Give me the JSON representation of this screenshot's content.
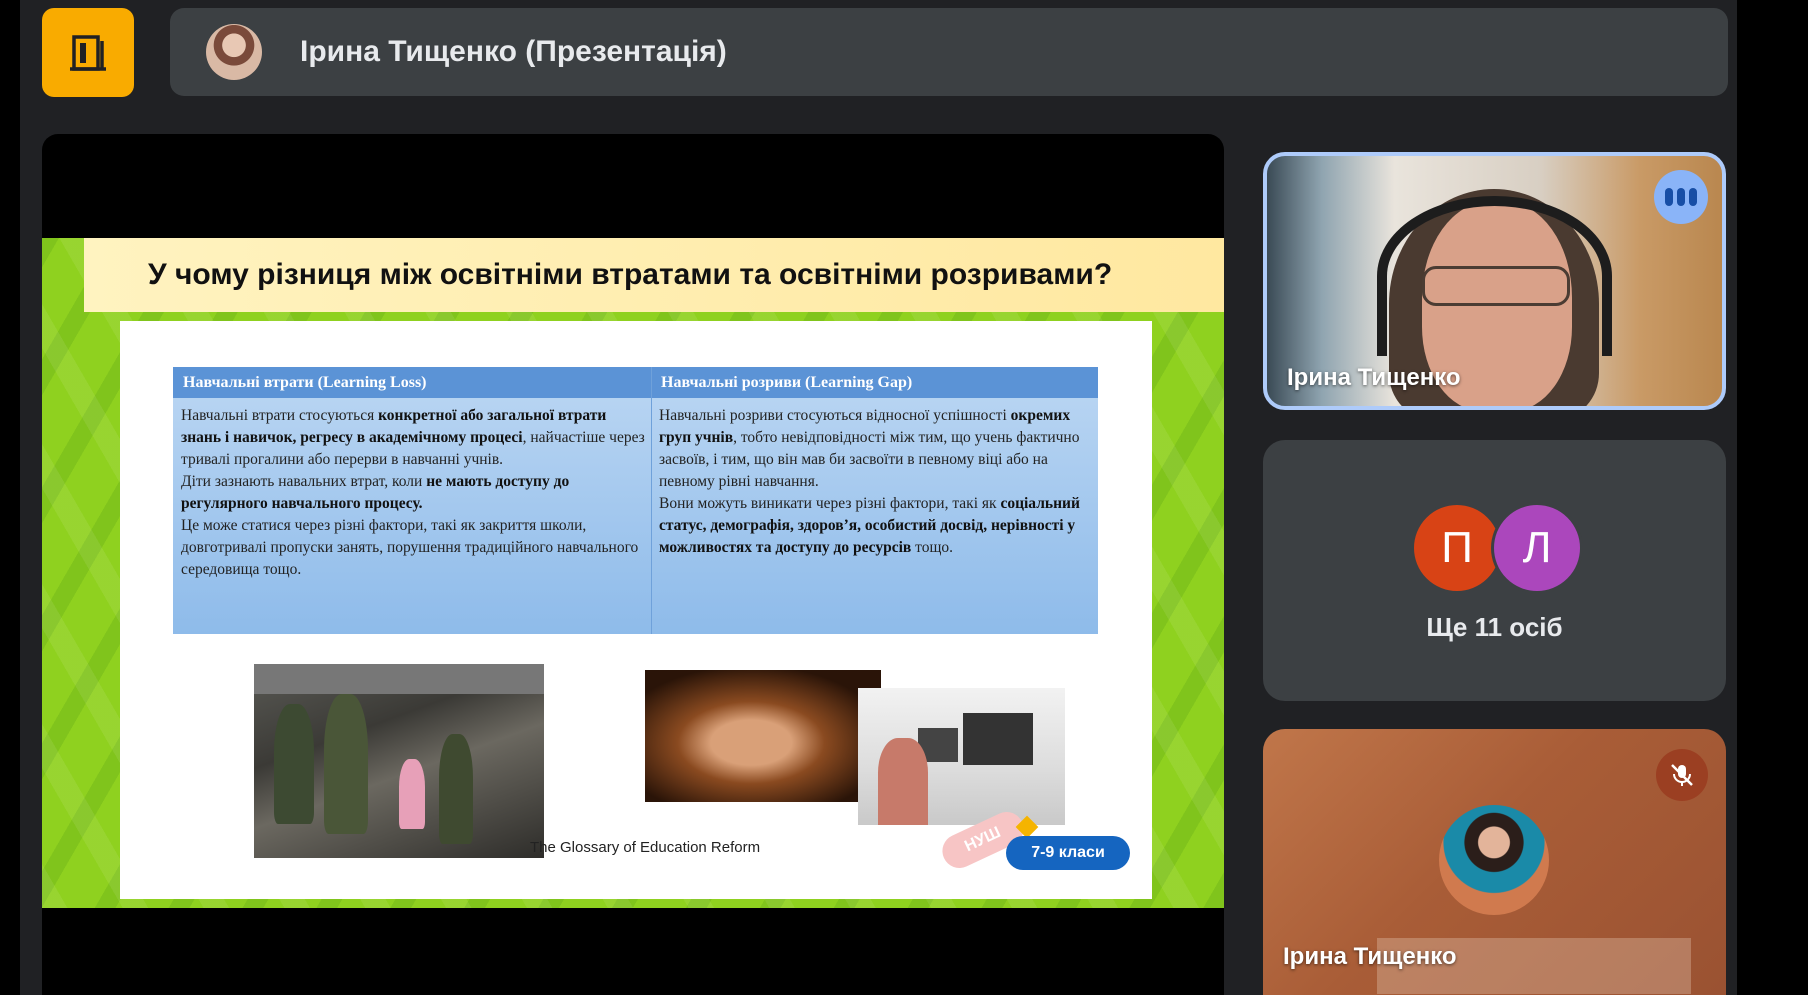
{
  "header": {
    "exit_icon": "door-exit-icon",
    "presenter_title": "Ірина Тищенко (Презентація)"
  },
  "slide": {
    "title": "У чому різниця між освітніми втратами та освітніми розривами?",
    "table": {
      "col1_header": "Навчальні втрати (Learning Loss)",
      "col2_header": "Навчальні розриви (Learning Gap)",
      "col1_text": [
        {
          "t": "Навчальні втрати стосуються ",
          "b": false
        },
        {
          "t": "конкретної або загальної втрати знань і навичок, регресу в академічному процесі",
          "b": true
        },
        {
          "t": ", найчастіше через тривалі прогалини або перерви в навчанні учнів.",
          "b": false
        },
        {
          "t": "\nДіти зазнають навальних втрат, коли ",
          "b": false
        },
        {
          "t": "не мають доступу до регулярного навчального процесу.",
          "b": true
        },
        {
          "t": "\nЦе може статися через різні фактори, такі як закриття школи, довготривалі пропуски занять, порушення традиційного навчального середовища тощо.",
          "b": false
        }
      ],
      "col2_text": [
        {
          "t": "Навчальні розриви стосуються відносної успішності ",
          "b": false
        },
        {
          "t": "окремих груп учнів",
          "b": true
        },
        {
          "t": ", тобто невідповідності між тим, що учень фактично засвоїв, і тим, що він мав би засвоїти в певному віці або на певному рівні навчання.",
          "b": false
        },
        {
          "t": "\nВони можуть виникати через різні фактори, такі як ",
          "b": false
        },
        {
          "t": "соціальний статус, демографія, здоров’я, особистий досвід, нерівності у можливостях та доступу до ресурсів",
          "b": true
        },
        {
          "t": " тощо.",
          "b": false
        }
      ]
    },
    "source": "The Glossary of Education Reform",
    "badge_nush": "НУШ",
    "badge_grades": "7-9 класи"
  },
  "participants": {
    "speaker_name": "Ірина Тищенко",
    "speaker_indicator_icon": "audio-level-icon",
    "avatar_p": "П",
    "avatar_l": "Л",
    "more_label": "Ще 11 осіб",
    "self_name": "Ірина Тищенко",
    "self_mute_icon": "mic-off-icon"
  }
}
